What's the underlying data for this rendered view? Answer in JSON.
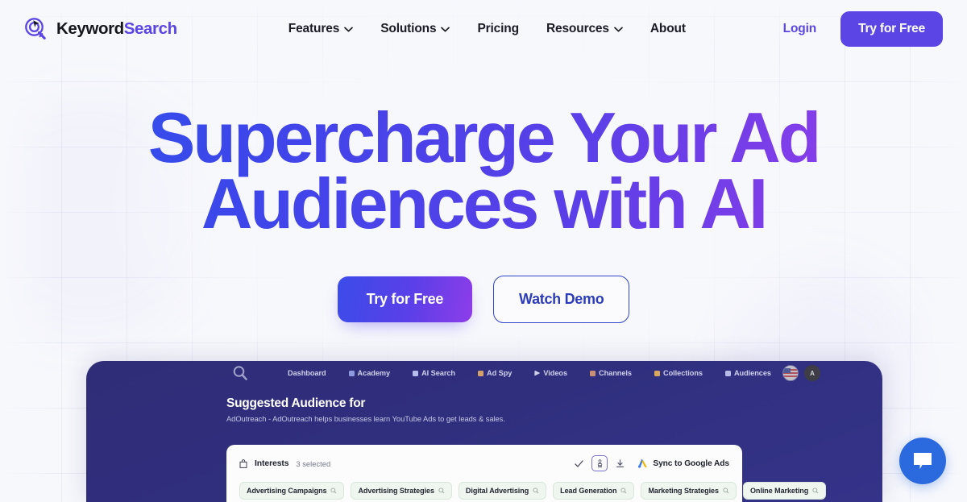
{
  "brand": {
    "name_part1": "Keyword",
    "name_part2": "Search",
    "logo_icon": "target-magnifier-cursor-icon",
    "accent_color": "#5b46e5"
  },
  "header": {
    "nav": [
      {
        "label": "Features",
        "has_dropdown": true
      },
      {
        "label": "Solutions",
        "has_dropdown": true
      },
      {
        "label": "Pricing",
        "has_dropdown": false
      },
      {
        "label": "Resources",
        "has_dropdown": true
      },
      {
        "label": "About",
        "has_dropdown": false
      }
    ],
    "login_label": "Login",
    "cta_label": "Try for Free"
  },
  "hero": {
    "title_line1": "Supercharge Your Ad",
    "title_line2": "Audiences with AI",
    "gradient_start": "#2f54ec",
    "gradient_end": "#9b40ea",
    "primary_cta": "Try for Free",
    "secondary_cta": "Watch Demo"
  },
  "app_mockup": {
    "search_icon": "search-icon",
    "nav": [
      {
        "label": "Dashboard",
        "icon": ""
      },
      {
        "label": "Academy",
        "icon": "academy-icon"
      },
      {
        "label": "AI Search",
        "icon": "sparkle-icon"
      },
      {
        "label": "Ad Spy",
        "icon": "adspy-icon"
      },
      {
        "label": "Videos",
        "icon": "play-icon"
      },
      {
        "label": "Channels",
        "icon": "channels-icon"
      },
      {
        "label": "Collections",
        "icon": "collections-icon"
      },
      {
        "label": "Audiences",
        "icon": "audiences-icon"
      }
    ],
    "flag_avatar": "us-flag-avatar",
    "user_initial": "A",
    "heading": "Suggested Audience for",
    "subheading": "AdOutreach - AdOutreach helps businesses learn YouTube Ads to get leads & sales.",
    "card": {
      "section_icon": "bag-icon",
      "section_label": "Interests",
      "selected_count": "3 selected",
      "actions": [
        {
          "name": "check-icon",
          "label": ""
        },
        {
          "name": "stamp-icon",
          "label": ""
        },
        {
          "name": "download-icon",
          "label": ""
        }
      ],
      "sync_label": "Sync to Google Ads",
      "sync_icon": "google-ads-icon",
      "tags": [
        "Advertising Campaigns",
        "Advertising Strategies",
        "Digital Advertising",
        "Lead Generation",
        "Marketing Strategies",
        "Online Marketing"
      ]
    }
  },
  "chat": {
    "icon": "chat-bubble-icon",
    "color": "#2b6ade"
  }
}
